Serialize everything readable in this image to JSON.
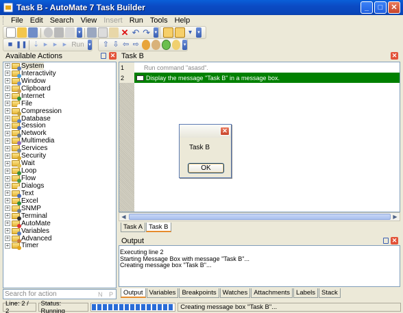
{
  "window": {
    "title": "Task B - AutoMate 7 Task Builder"
  },
  "menu": [
    {
      "label": "File",
      "enabled": true
    },
    {
      "label": "Edit",
      "enabled": true
    },
    {
      "label": "Search",
      "enabled": true
    },
    {
      "label": "View",
      "enabled": true
    },
    {
      "label": "Insert",
      "enabled": false
    },
    {
      "label": "Run",
      "enabled": true
    },
    {
      "label": "Tools",
      "enabled": true
    },
    {
      "label": "Help",
      "enabled": true
    }
  ],
  "toolbar2": {
    "run_label": "Run"
  },
  "actions_panel": {
    "title": "Available Actions",
    "items": [
      "System",
      "Interactivity",
      "Window",
      "Clipboard",
      "Internet",
      "File",
      "Compression",
      "Database",
      "Session",
      "Network",
      "Multimedia",
      "Services",
      "Security",
      "Wait",
      "Loop",
      "Flow",
      "Dialogs",
      "Text",
      "Excel",
      "SNMP",
      "Terminal",
      "AutoMate",
      "Variables",
      "Advanced",
      "Timer"
    ],
    "search_placeholder": "Search for action",
    "search_next": "N",
    "search_prev": "P"
  },
  "editor": {
    "title": "Task B",
    "lines": [
      {
        "num": "1",
        "text": "Run command \"asasd\"."
      },
      {
        "num": "2",
        "text": "Display the message \"Task B\" in a message box."
      }
    ]
  },
  "task_tabs": [
    "Task A",
    "Task B"
  ],
  "output_panel": {
    "title": "Output",
    "lines": [
      "Executing line 2",
      "Starting Message Box with message \"Task B\"...",
      "Creating message box \"Task B\"..."
    ]
  },
  "bottom_tabs": [
    "Output",
    "Variables",
    "Breakpoints",
    "Watches",
    "Attachments",
    "Labels",
    "Stack"
  ],
  "dialog": {
    "message": "Task B",
    "ok_label": "OK"
  },
  "status": {
    "line": "Line: 2 / 2",
    "state": "Status: Running",
    "message": "Creating message box \"Task B\"..."
  },
  "colors": {
    "active_line": "#008000",
    "title_bar": "#0a4bc4"
  }
}
